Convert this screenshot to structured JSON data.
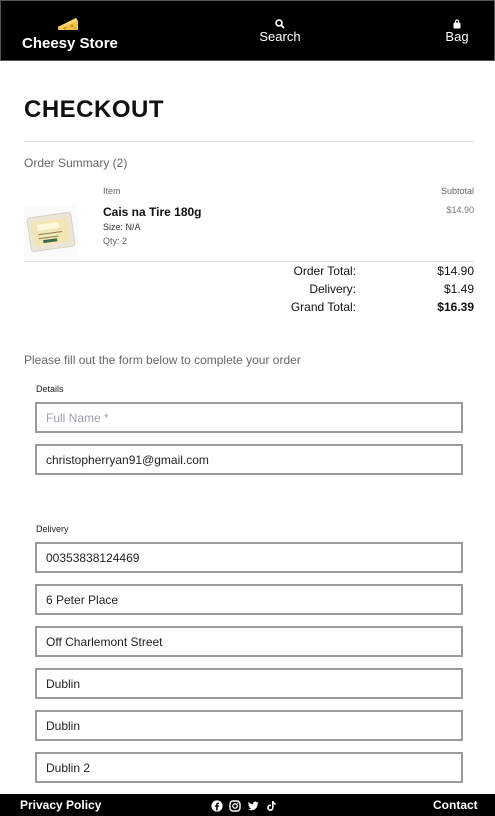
{
  "header": {
    "brand": "Cheesy Store",
    "search_label": "Search",
    "bag_label": "Bag",
    "background": "#000000"
  },
  "page": {
    "title": "CHECKOUT"
  },
  "summary": {
    "heading": "Order Summary (2)",
    "col_item": "Item",
    "col_subtotal": "Subtotal",
    "items": [
      {
        "name": "Cais na Tire 180g",
        "size": "Size: N/A",
        "qty": "Qty: 2",
        "subtotal": "$14.90"
      }
    ],
    "totals": {
      "order_total_label": "Order Total:",
      "order_total": "$14.90",
      "delivery_label": "Delivery:",
      "delivery": "$1.49",
      "grand_total_label": "Grand Total:",
      "grand_total": "$16.39"
    }
  },
  "form": {
    "intro": "Please fill out the form below to complete your order",
    "details_label": "Details",
    "full_name": {
      "value": "",
      "placeholder": "Full Name *"
    },
    "email": {
      "value": "christopherryan91@gmail.com"
    },
    "delivery_label": "Delivery",
    "phone": {
      "value": "00353838124469"
    },
    "street1": {
      "value": "6 Peter Place"
    },
    "street2": {
      "value": "Off Charlemont Street"
    },
    "town": {
      "value": "Dublin"
    },
    "county": {
      "value": "Dublin"
    },
    "postcode": {
      "value": "Dublin 2"
    }
  },
  "footer": {
    "privacy": "Privacy Policy",
    "contact": "Contact",
    "social_icons": [
      "facebook-icon",
      "instagram-icon",
      "twitter-icon",
      "tiktok-icon"
    ]
  }
}
